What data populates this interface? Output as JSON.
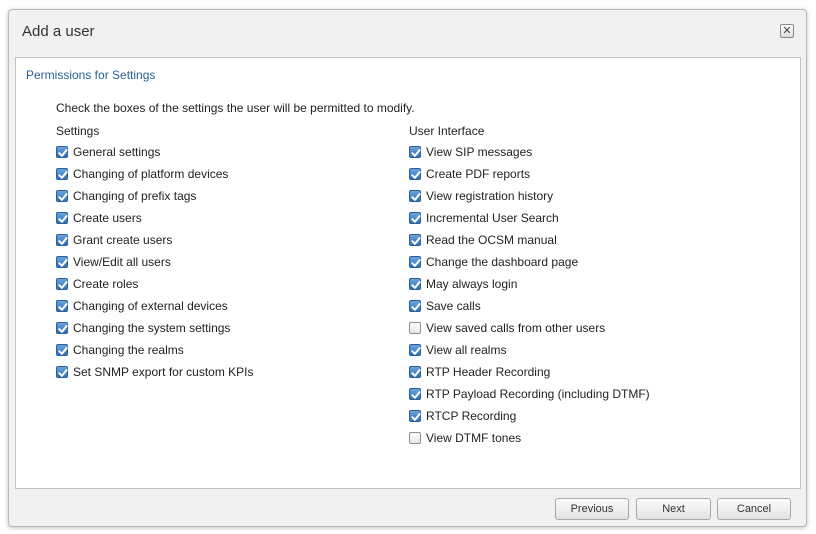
{
  "dialog": {
    "title": "Add a user",
    "close_glyph": "✕"
  },
  "panel": {
    "section_title": "Permissions for Settings",
    "intro": "Check the boxes of the settings the user will be permitted to modify."
  },
  "columns": [
    {
      "heading": "Settings",
      "items": [
        {
          "label": "General settings",
          "checked": true
        },
        {
          "label": "Changing of platform devices",
          "checked": true
        },
        {
          "label": "Changing of prefix tags",
          "checked": true
        },
        {
          "label": "Create users",
          "checked": true
        },
        {
          "label": "Grant create users",
          "checked": true
        },
        {
          "label": "View/Edit all users",
          "checked": true
        },
        {
          "label": "Create roles",
          "checked": true
        },
        {
          "label": "Changing of external devices",
          "checked": true
        },
        {
          "label": "Changing the system settings",
          "checked": true
        },
        {
          "label": "Changing the realms",
          "checked": true
        },
        {
          "label": "Set SNMP export for custom KPIs",
          "checked": true
        }
      ]
    },
    {
      "heading": "User Interface",
      "items": [
        {
          "label": "View SIP messages",
          "checked": true
        },
        {
          "label": "Create PDF reports",
          "checked": true
        },
        {
          "label": "View registration history",
          "checked": true
        },
        {
          "label": "Incremental User Search",
          "checked": true
        },
        {
          "label": "Read the OCSM manual",
          "checked": true
        },
        {
          "label": "Change the dashboard page",
          "checked": true
        },
        {
          "label": "May always login",
          "checked": true
        },
        {
          "label": "Save calls",
          "checked": true
        },
        {
          "label": "View saved calls from other users",
          "checked": false
        },
        {
          "label": "View all realms",
          "checked": true
        },
        {
          "label": "RTP Header Recording",
          "checked": true
        },
        {
          "label": "RTP Payload Recording (including DTMF)",
          "checked": true
        },
        {
          "label": "RTCP Recording",
          "checked": true
        },
        {
          "label": "View DTMF tones",
          "checked": false
        }
      ]
    }
  ],
  "footer": {
    "previous_label": "Previous",
    "next_label": "Next",
    "cancel_label": "Cancel"
  },
  "colors": {
    "accent": "#2a5f94",
    "checkbox_checked": "#2f6fb3"
  }
}
